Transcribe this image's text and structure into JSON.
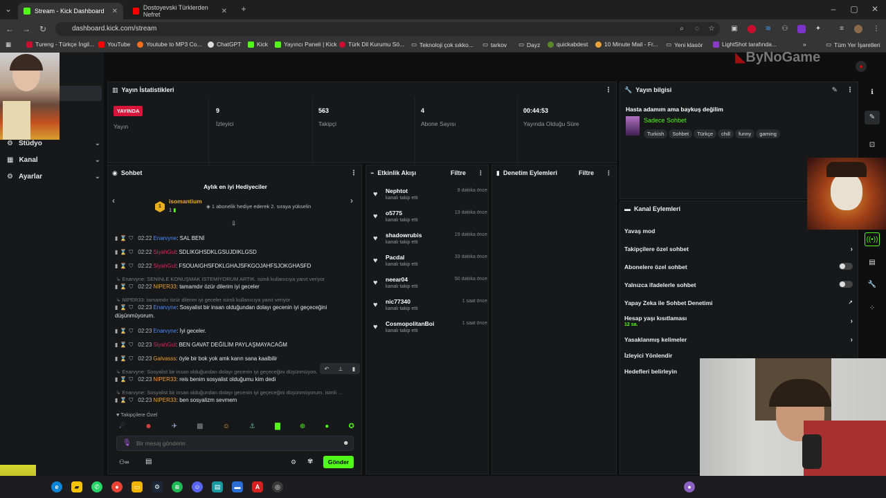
{
  "browser": {
    "tabs": [
      {
        "label": "Stream - Kick Dashboard",
        "active": true
      },
      {
        "label": "Dostoyevski Türklerden Nefret",
        "active": false
      }
    ],
    "url": "dashboard.kick.com/stream",
    "bookmarks": [
      "Tureng - Türkçe İngil...",
      "YouTube",
      "Youtube to MP3 Co...",
      "ChatGPT",
      "Kick",
      "Yayıncı Paneli | Kick",
      "Türk Dil Kurumu Sö...",
      "Teknoloji çok sıkko...",
      "tarkov",
      "Dayz",
      "quickabdest",
      "10 Minute Mail - Fr...",
      "Yeni klasör",
      "LightShot tarafında...",
      "Tüm Yer İşaretleri"
    ]
  },
  "watermark": "ByNoGame",
  "sidebar": {
    "items": [
      {
        "label": "Stüdyo"
      },
      {
        "label": "Kanal"
      },
      {
        "label": "Ayarlar"
      }
    ]
  },
  "stats": {
    "title": "Yayın İstatistikleri",
    "live_badge": "YAYINDA",
    "live_label": "Yayın",
    "viewers": {
      "value": "9",
      "label": "İzleyici"
    },
    "followers": {
      "value": "563",
      "label": "Takipçi"
    },
    "subs": {
      "value": "4",
      "label": "Abone Sayısı"
    },
    "uptime": {
      "value": "00:44:53",
      "label": "Yayında Olduğu Süre"
    }
  },
  "stream_info": {
    "title": "Yayın bilgisi",
    "stream_title": "Hasta adamım ama baykuş değilim",
    "category": "Sadece Sohbet",
    "tags": [
      "Turkish",
      "Sohbet",
      "Türkçe",
      "chill",
      "funny",
      "gaming"
    ]
  },
  "chat": {
    "title": "Sohbet",
    "gifters_title": "Aylık en iyi Hediyeciler",
    "top_gifter": "isomantium",
    "top_gifter_count": "1",
    "gifter_note": "1 abonelik hediye ederek 2. sıraya yükselin",
    "messages": [
      {
        "time": "02:22",
        "user": "Enarvyne",
        "color": "#4b8bff",
        "text": ": SAL BENİ"
      },
      {
        "time": "02:22",
        "user": "SiyahGul",
        "color": "#e0245e",
        "text": ": SDLIKGHSDKLGSUJDIKLGSD"
      },
      {
        "time": "02:22",
        "user": "SiyahGul",
        "color": "#e0245e",
        "text": ": FSOUAIGHSFDKLGHAJSFKGOJAHFSJOKGHASFD"
      },
      {
        "time": "02:22",
        "user": "NIPER33",
        "color": "#f0a030",
        "text": ": tamamdır özür dilerim iyi geceler"
      },
      {
        "time": "02:23",
        "user": "Enarvyne",
        "color": "#4b8bff",
        "text": ": Sosyalist bir insan olduğundan dolayı gecenin iyi geçeceğini düşünmüyorum."
      },
      {
        "time": "02:23",
        "user": "Enarvyne",
        "color": "#4b8bff",
        "text": ": İyi geceler."
      },
      {
        "time": "02:23",
        "user": "SiyahGul",
        "color": "#e0245e",
        "text": ": BEN GAVAT DEĞİLİM PAYLAŞMAYACAĞM"
      },
      {
        "time": "02:23",
        "user": "Galvasss",
        "color": "#f0a030",
        "text": ": öyle bir bok yok amk karın sana kaalbilir"
      },
      {
        "time": "02:23",
        "user": "NIPER33",
        "color": "#f0a030",
        "text": ": reis benim sosyalist olduğumu kim dedi"
      },
      {
        "time": "02:23",
        "user": "NIPER33",
        "color": "#f0a030",
        "text": ": ben sosyalizm sevmem"
      }
    ],
    "replies": [
      "Enarvyne: SENİNLE KONUŞMAK İSTEMİYORUM ARTIK. isimli kullanıcıya yanıt veriyor",
      "NIPER33: tamamdır özür dilerim iyi geceler isimli kullanıcıya yanıt veriyor",
      "Enarvyne: Sosyalist bir insan olduğundan dolayı gecenin iyi geçeceğini düşünmüyorum.",
      "Enarvyne: Sosyalist bir insan olduğundan dolayı gecenin iyi geçeceğini düşünmüyorum. isimli ..."
    ],
    "followers_only": "Takipçilere Özel",
    "input_placeholder": "Bir mesaj gönderin",
    "send_label": "Gönder"
  },
  "activity": {
    "title": "Etkinlik Akışı",
    "filter": "Filtre",
    "events": [
      {
        "name": "Nephtot",
        "sub": "kanalı takip etti",
        "time": "9 dakika önce"
      },
      {
        "name": "o5775",
        "sub": "kanalı takip etti",
        "time": "13 dakika önce"
      },
      {
        "name": "shadowrubis",
        "sub": "kanalı takip etti",
        "time": "19 dakika önce"
      },
      {
        "name": "Pacdal",
        "sub": "kanalı takip etti",
        "time": "33 dakika önce"
      },
      {
        "name": "neear04",
        "sub": "kanalı takip etti",
        "time": "50 dakika önce"
      },
      {
        "name": "nic77340",
        "sub": "kanalı takip etti",
        "time": "1 saat önce"
      },
      {
        "name": "CosmopolitanBoi",
        "sub": "kanalı takip etti",
        "time": "1 saat önce"
      }
    ]
  },
  "moderation": {
    "title": "Denetim Eylemleri",
    "filter": "Filtre"
  },
  "channel_actions": {
    "title": "Kanal Eylemleri",
    "items": [
      {
        "label": "Yavaş mod"
      },
      {
        "label": "Takipçilere özel sohbet"
      },
      {
        "label": "Abonelere özel sohbet"
      },
      {
        "label": "Yalnızca ifadelerle sohbet"
      },
      {
        "label": "Yapay Zeka ile Sohbet Denetimi"
      },
      {
        "label": "Hesap yaşı kısıtlaması",
        "sub": "12 sa."
      },
      {
        "label": "Yasaklanmış kelimeler"
      },
      {
        "label": "İzleyici Yönlendir"
      },
      {
        "label": "Hedefleri belirleyin"
      }
    ]
  }
}
